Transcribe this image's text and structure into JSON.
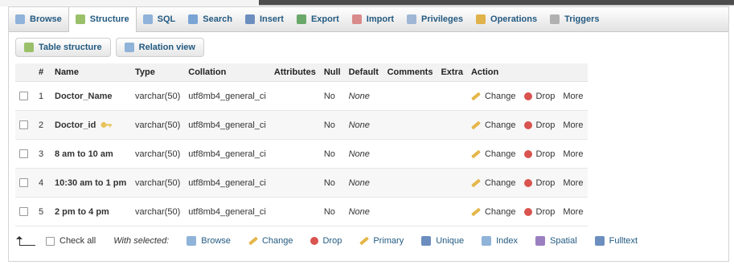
{
  "tabs": [
    {
      "label": "Browse",
      "icon": "browse-icon",
      "color": "#8fb3d9"
    },
    {
      "label": "Structure",
      "icon": "structure-icon",
      "color": "#9ac16a",
      "active": true
    },
    {
      "label": "SQL",
      "icon": "sql-icon",
      "color": "#8fb3d9"
    },
    {
      "label": "Search",
      "icon": "search-icon",
      "color": "#7aa4d4"
    },
    {
      "label": "Insert",
      "icon": "insert-icon",
      "color": "#6c8ebf"
    },
    {
      "label": "Export",
      "icon": "export-icon",
      "color": "#6aa86a"
    },
    {
      "label": "Import",
      "icon": "import-icon",
      "color": "#d98a8a"
    },
    {
      "label": "Privileges",
      "icon": "privileges-icon",
      "color": "#9fb7d4"
    },
    {
      "label": "Operations",
      "icon": "operations-icon",
      "color": "#e0b24a"
    },
    {
      "label": "Triggers",
      "icon": "triggers-icon",
      "color": "#b0b0b0"
    }
  ],
  "subtabs": [
    {
      "label": "Table structure",
      "icon": "table-structure-icon"
    },
    {
      "label": "Relation view",
      "icon": "relation-view-icon"
    }
  ],
  "table": {
    "headers": [
      "#",
      "Name",
      "Type",
      "Collation",
      "Attributes",
      "Null",
      "Default",
      "Comments",
      "Extra",
      "Action"
    ],
    "rows": [
      {
        "num": "1",
        "name": "Doctor_Name",
        "type": "varchar(50)",
        "collation": "utf8mb4_general_ci",
        "attributes": "",
        "null": "No",
        "default": "None",
        "comments": "",
        "extra": ""
      },
      {
        "num": "2",
        "name": "Doctor_id",
        "type": "varchar(50)",
        "collation": "utf8mb4_general_ci",
        "attributes": "",
        "null": "No",
        "default": "None",
        "comments": "",
        "extra": "",
        "key": true
      },
      {
        "num": "3",
        "name": "8 am to 10 am",
        "type": "varchar(50)",
        "collation": "utf8mb4_general_ci",
        "attributes": "",
        "null": "No",
        "default": "None",
        "comments": "",
        "extra": ""
      },
      {
        "num": "4",
        "name": "10:30 am to 1 pm",
        "type": "varchar(50)",
        "collation": "utf8mb4_general_ci",
        "attributes": "",
        "null": "No",
        "default": "None",
        "comments": "",
        "extra": ""
      },
      {
        "num": "5",
        "name": "2 pm to 4 pm",
        "type": "varchar(50)",
        "collation": "utf8mb4_general_ci",
        "attributes": "",
        "null": "No",
        "default": "None",
        "comments": "",
        "extra": ""
      }
    ],
    "actions": {
      "change": "Change",
      "drop": "Drop",
      "more": "More"
    }
  },
  "bottom": {
    "check_all": "Check all",
    "with_selected": "With selected:",
    "actions": [
      {
        "label": "Browse",
        "icon": "browse-icon",
        "color": "#8fb3d9"
      },
      {
        "label": "Change",
        "icon": "pencil-icon",
        "color": "#e5b64a"
      },
      {
        "label": "Drop",
        "icon": "drop-icon",
        "color": "#d9534f"
      },
      {
        "label": "Primary",
        "icon": "primary-key-icon",
        "color": "#e5b64a"
      },
      {
        "label": "Unique",
        "icon": "unique-icon",
        "color": "#6c8ebf"
      },
      {
        "label": "Index",
        "icon": "index-icon",
        "color": "#8fb3d9"
      },
      {
        "label": "Spatial",
        "icon": "spatial-icon",
        "color": "#9a7fc0"
      },
      {
        "label": "Fulltext",
        "icon": "fulltext-icon",
        "color": "#6c8ebf"
      }
    ]
  }
}
